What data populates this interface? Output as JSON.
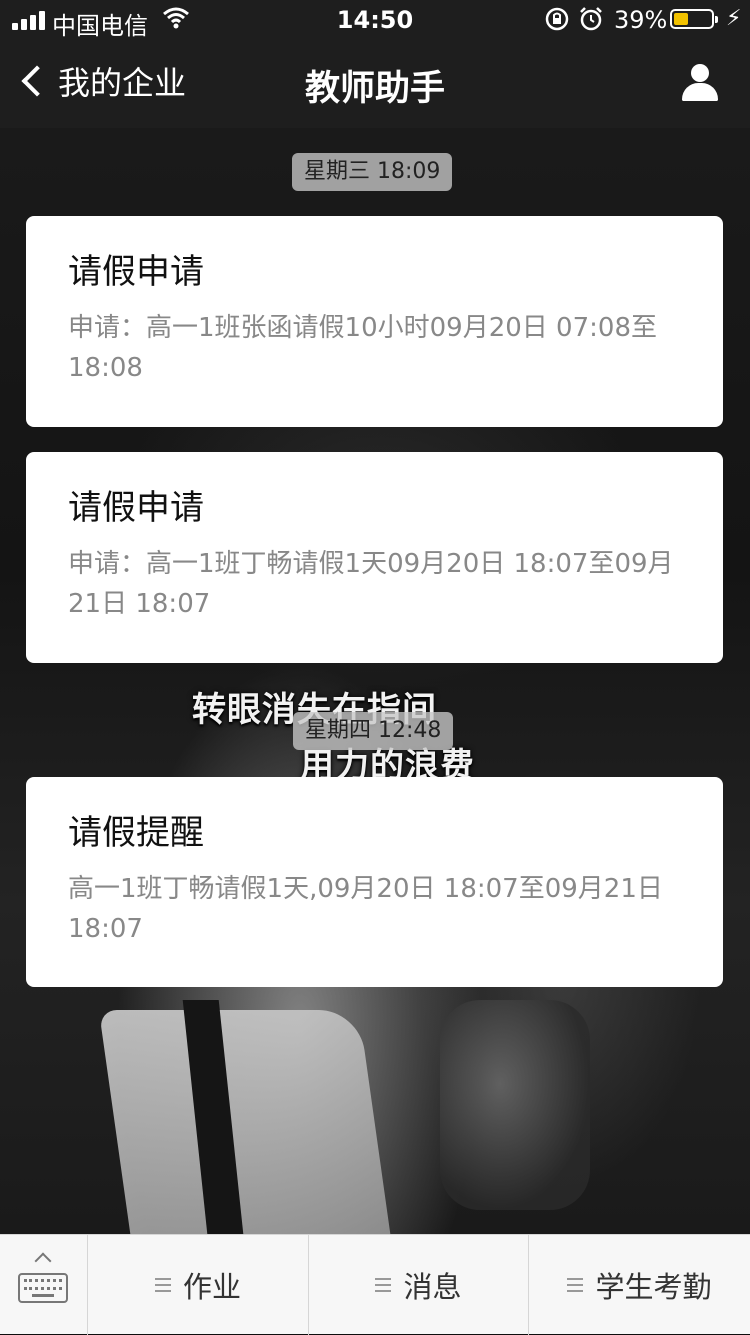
{
  "status_bar": {
    "carrier": "中国电信",
    "time": "14:50",
    "battery_percent": "39%",
    "battery_level": 0.39,
    "battery_color": "#f2c200"
  },
  "nav": {
    "back_label": "我的企业",
    "title": "教师助手"
  },
  "background_lyrics": [
    "转眼消失在指间",
    "用力的浪费"
  ],
  "messages": [
    {
      "time": "星期三 18:09",
      "title": "请假申请",
      "body": "申请：高一1班张函请假10小时09月20日 07:08至18:08"
    },
    {
      "title": "请假申请",
      "body": "申请：高一1班丁畅请假1天09月20日 18:07至09月21日 18:07"
    },
    {
      "time": "星期四 12:48",
      "title": "请假提醒",
      "body": "高一1班丁畅请假1天,09月20日 18:07至09月21日 18:07"
    }
  ],
  "bottom_menu": {
    "items": [
      {
        "label": "作业"
      },
      {
        "label": "消息"
      },
      {
        "label": "学生考勤"
      }
    ]
  },
  "icons": {
    "keyboard": "keyboard-icon",
    "menu": "menu-lines-icon",
    "profile": "person-icon",
    "back": "chevron-left-icon"
  }
}
